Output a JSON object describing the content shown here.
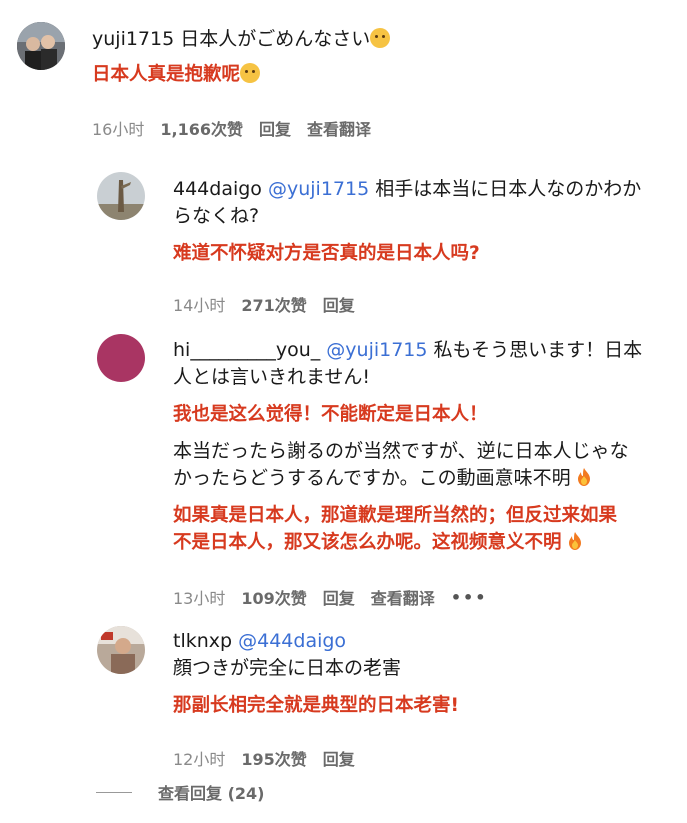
{
  "comments": [
    {
      "user": "yuji1715",
      "mention": "",
      "text1": "日本人がごめんなさい",
      "text2": "",
      "translation1": "日本人真是抱歉呢",
      "translation2": "",
      "text3": "",
      "text4": "",
      "translation3": "",
      "translation4": "",
      "time": "16小时",
      "likes": "1,166次赞",
      "reply": "回复",
      "translate": "查看翻译"
    },
    {
      "user": "444daigo",
      "mention": "@yuji1715",
      "text1": "相手は本当に日本人なのかわか",
      "text2": "らなくね?",
      "translation1": "难道不怀疑对方是否真的是日本人吗?",
      "time": "14小时",
      "likes": "271次赞",
      "reply": "回复"
    },
    {
      "user": "hi_________you_",
      "mention": "@yuji1715",
      "text1": "私もそう思います！日本",
      "text2": "人とは言いきれません!",
      "translation1": "我也是这么觉得！不能断定是日本人！",
      "text3": "本当だったら謝るのが当然ですが、逆に日本人じゃな",
      "text4": "かったらどうするんですか。この動画意味不明",
      "translation3": "如果真是日本人，那道歉是理所当然的；但反过来如果",
      "translation4": "不是日本人，那又该怎么办呢。这视频意义不明",
      "time": "13小时",
      "likes": "109次赞",
      "reply": "回复",
      "translate": "查看翻译",
      "more": "•••"
    },
    {
      "user": "tlknxp",
      "mention": "@444daigo",
      "text1": "顔つきが完全に日本の老害",
      "translation1": "那副长相完全就是典型的日本老害!",
      "time": "12小时",
      "likes": "195次赞",
      "reply": "回复"
    }
  ],
  "view_replies": "查看回复 (24)",
  "colors": {
    "translation": "#d73a1f",
    "mention": "#3b6fd4",
    "meta": "#8a8a8a"
  }
}
